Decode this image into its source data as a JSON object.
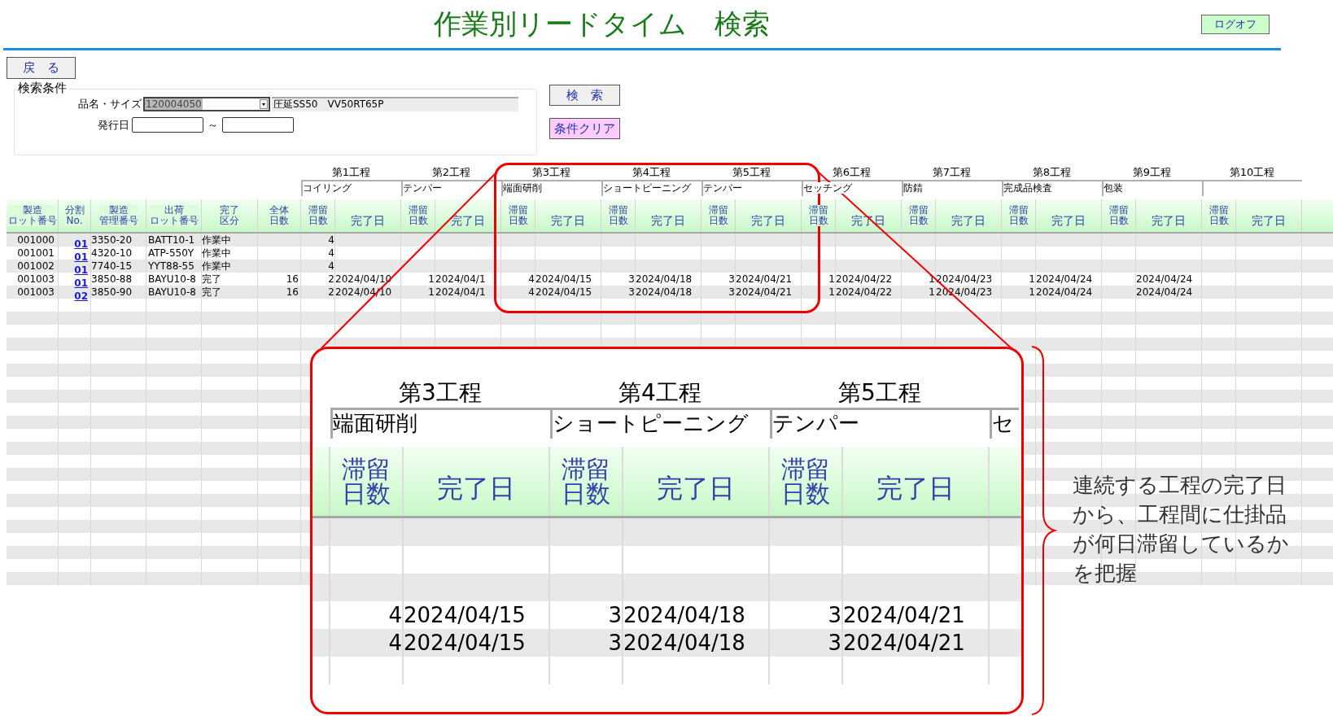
{
  "title": "作業別リードタイム　検索",
  "logoff_button": "ログオフ",
  "back_button": "戻　る",
  "search": {
    "legend": "検索条件",
    "product_label": "品名・サイズ",
    "product_code": "120004050",
    "product_name": "圧延SS50　VV50RT65P",
    "date_label": "発行日",
    "range_mark": "～",
    "search_button": "検　索",
    "clear_button": "条件クリア"
  },
  "table": {
    "columns": [
      {
        "lines": [
          "製造",
          "ロット番号"
        ]
      },
      {
        "lines": [
          "分割",
          "No."
        ]
      },
      {
        "lines": [
          "製造",
          "管理番号"
        ]
      },
      {
        "lines": [
          "出荷",
          "ロット番号"
        ]
      },
      {
        "lines": [
          "完了",
          "区分"
        ]
      },
      {
        "lines": [
          "全体",
          "日数"
        ]
      }
    ],
    "processes": [
      {
        "label": "第1工程",
        "name": "コイリング",
        "days_header": [
          "滞留",
          "日数"
        ],
        "date_header": "完了日"
      },
      {
        "label": "第2工程",
        "name": "テンパー",
        "days_header": [
          "滞留",
          "日数"
        ],
        "date_header": "完了日"
      },
      {
        "label": "第3工程",
        "name": "端面研削",
        "days_header": [
          "滞留",
          "日数"
        ],
        "date_header": "完了日"
      },
      {
        "label": "第4工程",
        "name": "ショートピーニング",
        "days_header": [
          "滞留",
          "日数"
        ],
        "date_header": "完了日"
      },
      {
        "label": "第5工程",
        "name": "テンパー",
        "days_header": [
          "滞留",
          "日数"
        ],
        "date_header": "完了日"
      },
      {
        "label": "第6工程",
        "name": "セッチング",
        "days_header": [
          "滞留",
          "日数"
        ],
        "date_header": "完了日"
      },
      {
        "label": "第7工程",
        "name": "防錆",
        "days_header": [
          "滞留",
          "日数"
        ],
        "date_header": "完了日"
      },
      {
        "label": "第8工程",
        "name": "完成品検査",
        "days_header": [
          "滞留",
          "日数"
        ],
        "date_header": "完了日"
      },
      {
        "label": "第9工程",
        "name": "包装",
        "days_header": [
          "滞留",
          "日数"
        ],
        "date_header": "完了日"
      },
      {
        "label": "第10工程",
        "days_header": [
          "滞留",
          "日数"
        ],
        "date_header": "完了日"
      }
    ],
    "rows": [
      {
        "lot": "001000",
        "split": "01",
        "control": "3350-20",
        "shipping": "BATT10-1",
        "status": "作業中",
        "steps": [
          {
            "days": "4"
          }
        ]
      },
      {
        "lot": "001001",
        "split": "01",
        "control": "4320-10",
        "shipping": "ATP-550Y",
        "status": "作業中",
        "steps": [
          {
            "days": "4"
          }
        ]
      },
      {
        "lot": "001002",
        "split": "01",
        "control": "7740-15",
        "shipping": "YYT88-55",
        "status": "作業中",
        "steps": [
          {
            "days": "4"
          }
        ]
      },
      {
        "lot": "001003",
        "split": "01",
        "control": "3850-88",
        "shipping": "BAYU10-8",
        "status": "完了",
        "total": "16",
        "steps": [
          {
            "days": "2",
            "date": "2024/04/10"
          },
          {
            "days": "1",
            "date": "2024/04/1"
          },
          {
            "days": "4",
            "date": "2024/04/15"
          },
          {
            "days": "3",
            "date": "2024/04/18"
          },
          {
            "days": "3",
            "date": "2024/04/21"
          },
          {
            "days": "1",
            "date": "2024/04/22"
          },
          {
            "days": "1",
            "date": "2024/04/23"
          },
          {
            "days": "1",
            "date": "2024/04/24"
          },
          {
            "date": "2024/04/24"
          }
        ]
      },
      {
        "lot": "001003",
        "split": "02",
        "control": "3850-90",
        "shipping": "BAYU10-8",
        "status": "完了",
        "total": "16",
        "steps": [
          {
            "days": "2",
            "date": "2024/04/10"
          },
          {
            "days": "1",
            "date": "2024/04/1"
          },
          {
            "days": "4",
            "date": "2024/04/15"
          },
          {
            "days": "3",
            "date": "2024/04/18"
          },
          {
            "days": "3",
            "date": "2024/04/21"
          },
          {
            "days": "1",
            "date": "2024/04/22"
          },
          {
            "days": "1",
            "date": "2024/04/23"
          },
          {
            "days": "1",
            "date": "2024/04/24"
          },
          {
            "date": "2024/04/24"
          }
        ]
      }
    ]
  },
  "callout": {
    "processes": [
      {
        "label": "第3工程",
        "name": "端面研削",
        "days_header": [
          "滞留",
          "日数"
        ],
        "date_header": "完了日"
      },
      {
        "label": "第4工程",
        "name": "ショートピーニング",
        "days_header": [
          "滞留",
          "日数"
        ],
        "date_header": "完了日"
      },
      {
        "label": "第5工程",
        "name": "テンパー",
        "days_header": [
          "滞留",
          "日数"
        ],
        "date_header": "完了日"
      }
    ],
    "next_name": "セ",
    "rows": [
      {
        "kind": "blank"
      },
      {
        "kind": "blank"
      },
      {
        "kind": "blank"
      },
      {
        "kind": "data",
        "steps": [
          {
            "days": "4",
            "date": "2024/04/15"
          },
          {
            "days": "3",
            "date": "2024/04/18"
          },
          {
            "days": "3",
            "date": "2024/04/21"
          }
        ]
      },
      {
        "kind": "data",
        "steps": [
          {
            "days": "4",
            "date": "2024/04/15"
          },
          {
            "days": "3",
            "date": "2024/04/18"
          },
          {
            "days": "3",
            "date": "2024/04/21"
          }
        ]
      },
      {
        "kind": "blank"
      }
    ]
  },
  "note": "連続する工程の完了日から、工程間に仕掛品が何日滞留しているかを把握"
}
